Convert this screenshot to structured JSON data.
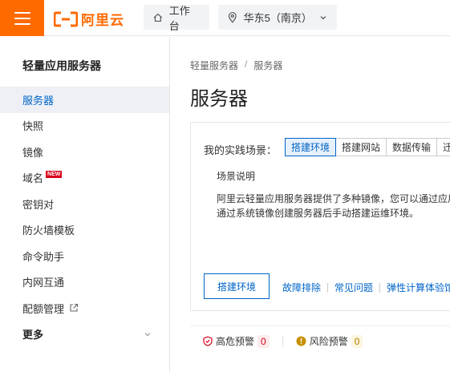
{
  "topbar": {
    "logo_text": "阿里云",
    "workbench_label": "工作台",
    "region_label": "华东5（南京）",
    "brand_color": "#ff6a00"
  },
  "sidebar": {
    "title": "轻量应用服务器",
    "items": [
      {
        "label": "服务器",
        "active": true
      },
      {
        "label": "快照"
      },
      {
        "label": "镜像"
      },
      {
        "label": "域名",
        "badge": "NEW"
      },
      {
        "label": "密钥对"
      },
      {
        "label": "防火墙模板"
      },
      {
        "label": "命令助手"
      },
      {
        "label": "内网互通"
      },
      {
        "label": "配额管理",
        "icon": "external-link-icon"
      },
      {
        "label": "更多",
        "icon": "chevron-down-icon"
      }
    ]
  },
  "breadcrumb": [
    "轻量服务器",
    "服务器"
  ],
  "page_title": "服务器",
  "practice": {
    "label": "我的实践场景：",
    "tabs": [
      "搭建环境",
      "搭建网站",
      "数据传输",
      "迁"
    ],
    "active_tab": 0,
    "desc_title": "场景说明",
    "desc_lines": [
      "阿里云轻量应用服务器提供了多种镜像，您可以通过应用",
      "通过系统镜像创建服务器后手动搭建运维环境。"
    ],
    "primary_button": "搭建环境",
    "links": [
      "故障排除",
      "常见问题",
      "弹性计算体验馆"
    ]
  },
  "alerts": {
    "high_label": "高危预警",
    "high_count": "0",
    "risk_label": "风险预警",
    "risk_count": "0"
  },
  "colors": {
    "accent": "#0064c8",
    "danger": "#d9001b",
    "warning": "#b37b00"
  }
}
